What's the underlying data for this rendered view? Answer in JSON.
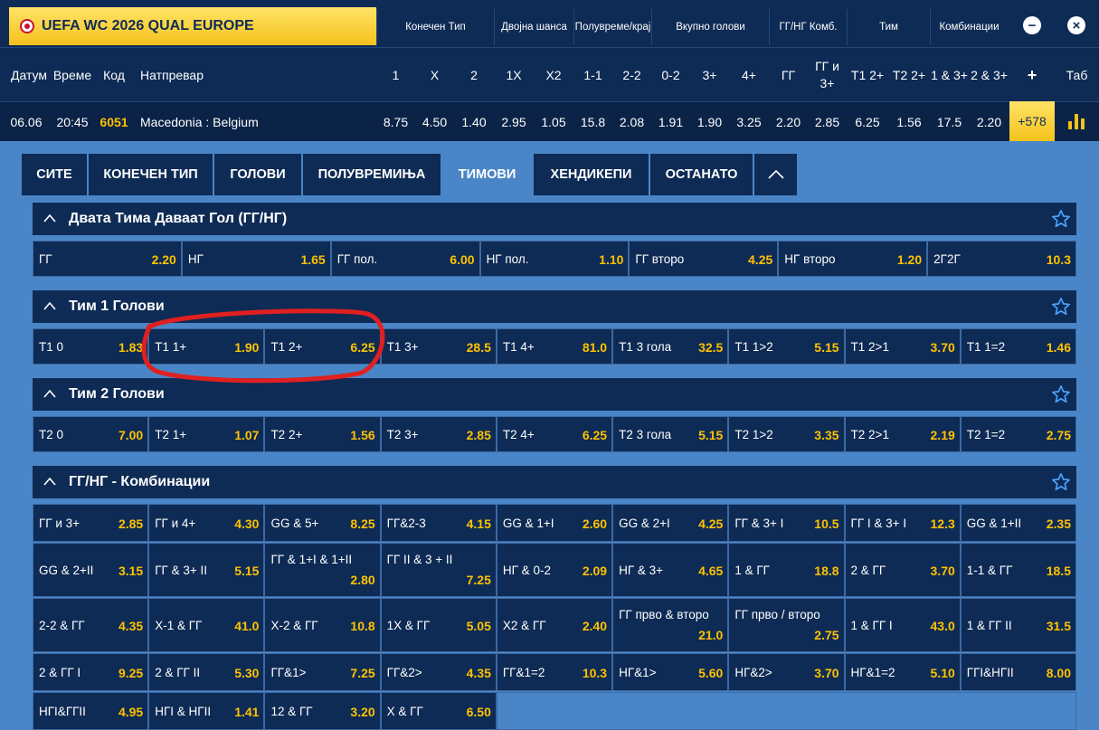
{
  "competition": {
    "title": "UEFA WC 2026 QUAL EUROPE",
    "flag_icon": "flag-icon"
  },
  "header_groups": [
    "Конечен Тип",
    "Двојна шанса",
    "Полувреме/крај",
    "Вкупно голови",
    "ГГ/НГ Комб.",
    "Тим",
    "Комбинации"
  ],
  "header_buttons": {
    "minus": "−",
    "close": "×"
  },
  "columns": {
    "left": [
      "Датум",
      "Време",
      "Код",
      "Натпревар"
    ],
    "odds": [
      "1",
      "X",
      "2",
      "1X",
      "X2",
      "1-1",
      "2-2",
      "0-2",
      "3+",
      "4+",
      "ГГ",
      "ГГ и 3+",
      "Т1 2+",
      "Т2 2+",
      "1 & 3+",
      "2 & 3+"
    ],
    "plus": "+",
    "tab": "Таб"
  },
  "match": {
    "date": "06.06",
    "time": "20:45",
    "code": "6051",
    "name": "Macedonia : Belgium",
    "odds": [
      "8.75",
      "4.50",
      "1.40",
      "2.95",
      "1.05",
      "15.8",
      "2.08",
      "1.91",
      "1.90",
      "3.25",
      "2.20",
      "2.85",
      "6.25",
      "1.56",
      "17.5",
      "2.20"
    ],
    "more": "+578",
    "stats_icon": "bar-chart-icon"
  },
  "tabs": [
    {
      "label": "СИТЕ",
      "active": false
    },
    {
      "label": "КОНЕЧЕН ТИП",
      "active": false
    },
    {
      "label": "ГОЛОВИ",
      "active": false
    },
    {
      "label": "ПОЛУВРЕМИЊА",
      "active": false
    },
    {
      "label": "ТИМОВИ",
      "active": true
    },
    {
      "label": "ХЕНДИКЕПИ",
      "active": false
    },
    {
      "label": "ОСТАНАТО",
      "active": false
    }
  ],
  "sections": [
    {
      "title": "Двата Тима Даваат Гол (ГГ/НГ)",
      "rows": [
        [
          [
            "ГГ",
            "2.20"
          ],
          [
            "НГ",
            "1.65"
          ],
          [
            "ГГ пол.",
            "6.00"
          ],
          [
            "НГ пол.",
            "1.10"
          ],
          [
            "ГГ второ",
            "4.25"
          ],
          [
            "НГ второ",
            "1.20"
          ],
          [
            "2Г2Г",
            "10.3"
          ]
        ]
      ]
    },
    {
      "title": "Тим 1 Голови",
      "rows": [
        [
          [
            "Т1 0",
            "1.83"
          ],
          [
            "Т1 1+",
            "1.90"
          ],
          [
            "Т1 2+",
            "6.25"
          ],
          [
            "Т1 3+",
            "28.5"
          ],
          [
            "Т1 4+",
            "81.0"
          ],
          [
            "Т1 3 гола",
            "32.5"
          ],
          [
            "Т1 1>2",
            "5.15"
          ],
          [
            "Т1 2>1",
            "3.70"
          ],
          [
            "Т1 1=2",
            "1.46"
          ]
        ]
      ]
    },
    {
      "title": "Тим 2 Голови",
      "rows": [
        [
          [
            "Т2 0",
            "7.00"
          ],
          [
            "Т2 1+",
            "1.07"
          ],
          [
            "Т2 2+",
            "1.56"
          ],
          [
            "Т2 3+",
            "2.85"
          ],
          [
            "Т2 4+",
            "6.25"
          ],
          [
            "Т2 3 гола",
            "5.15"
          ],
          [
            "Т2 1>2",
            "3.35"
          ],
          [
            "Т2 2>1",
            "2.19"
          ],
          [
            "Т2 1=2",
            "2.75"
          ]
        ]
      ]
    },
    {
      "title": "ГГ/НГ - Комбинации",
      "rows": [
        [
          [
            "ГГ и 3+",
            "2.85"
          ],
          [
            "ГГ и 4+",
            "4.30"
          ],
          [
            "GG & 5+",
            "8.25"
          ],
          [
            "ГГ&2-3",
            "4.15"
          ],
          [
            "GG & 1+I",
            "2.60"
          ],
          [
            "GG & 2+I",
            "4.25"
          ],
          [
            "ГГ & 3+ I",
            "10.5"
          ],
          [
            "ГГ I & 3+ I",
            "12.3"
          ],
          [
            "GG & 1+II",
            "2.35"
          ]
        ],
        [
          [
            "GG & 2+II",
            "3.15"
          ],
          [
            "ГГ & 3+ II",
            "5.15"
          ],
          [
            "ГГ & 1+I & 1+II",
            "2.80"
          ],
          [
            "ГГ II & 3 + II",
            "7.25"
          ],
          [
            "НГ & 0-2",
            "2.09"
          ],
          [
            "НГ & 3+",
            "4.65"
          ],
          [
            "1 & ГГ",
            "18.8"
          ],
          [
            "2 & ГГ",
            "3.70"
          ],
          [
            "1-1 & ГГ",
            "18.5"
          ]
        ],
        [
          [
            "2-2 & ГГ",
            "4.35"
          ],
          [
            "X-1 & ГГ",
            "41.0"
          ],
          [
            "X-2 & ГГ",
            "10.8"
          ],
          [
            "1X & ГГ",
            "5.05"
          ],
          [
            "X2 & ГГ",
            "2.40"
          ],
          [
            "ГГ прво & второ",
            "21.0"
          ],
          [
            "ГГ прво / второ",
            "2.75"
          ],
          [
            "1 & ГГ I",
            "43.0"
          ],
          [
            "1 & ГГ II",
            "31.5"
          ]
        ],
        [
          [
            "2 & ГГ I",
            "9.25"
          ],
          [
            "2 & ГГ II",
            "5.30"
          ],
          [
            "ГГ&1>",
            "7.25"
          ],
          [
            "ГГ&2>",
            "4.35"
          ],
          [
            "ГГ&1=2",
            "10.3"
          ],
          [
            "НГ&1>",
            "5.60"
          ],
          [
            "НГ&2>",
            "3.70"
          ],
          [
            "НГ&1=2",
            "5.10"
          ],
          [
            "ГГI&НГII",
            "8.00"
          ]
        ],
        [
          [
            "НГI&ГГII",
            "4.95"
          ],
          [
            "НГI & НГII",
            "1.41"
          ],
          [
            "12 & ГГ",
            "3.20"
          ],
          [
            "X & ГГ",
            "6.50"
          ]
        ]
      ]
    }
  ],
  "colors": {
    "navy": "#0e2b55",
    "blue": "#4a86c7",
    "odd": "#ffc200",
    "annotation": "#e02020"
  }
}
